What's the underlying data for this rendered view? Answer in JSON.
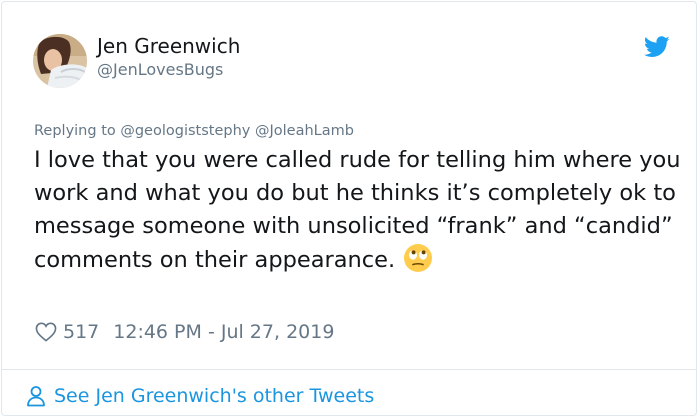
{
  "author": {
    "name": "Jen Greenwich",
    "handle": "@JenLovesBugs"
  },
  "replying_to": "Replying to @geologiststephy @JoleahLamb",
  "tweet": {
    "text": "I love that you were called rude for telling him where you work and what you do but he thinks it’s completely ok to message someone with unsolicited “frank” and “candid” comments on their appearance.",
    "emoji": "face-with-rolling-eyes"
  },
  "meta": {
    "likes": "517",
    "timestamp": "12:46 PM - Jul 27, 2019"
  },
  "footer": {
    "see_more": "See Jen Greenwich's other Tweets"
  },
  "colors": {
    "text": "#14171a",
    "secondary": "#657786",
    "link": "#1b95e0",
    "twitter_blue": "#1da1f2",
    "border": "#e1e8ed"
  },
  "icons": {
    "brand": "twitter-bird-icon",
    "like": "heart-icon",
    "profile": "person-icon"
  }
}
